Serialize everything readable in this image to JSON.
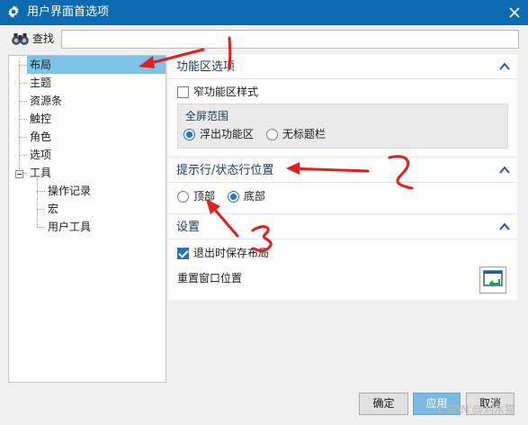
{
  "window": {
    "title": "用户界面首选项",
    "accent": "#0c6bb0"
  },
  "search": {
    "label": "查找",
    "value": ""
  },
  "tree": {
    "items": [
      {
        "label": "布局",
        "selected": true
      },
      {
        "label": "主题"
      },
      {
        "label": "资源条"
      },
      {
        "label": "触控"
      },
      {
        "label": "角色"
      },
      {
        "label": "选项"
      },
      {
        "label": "工具",
        "expanded": true
      },
      {
        "label": "操作记录"
      },
      {
        "label": "宏"
      },
      {
        "label": "用户工具"
      }
    ]
  },
  "sections": {
    "ribbon": {
      "title": "功能区选项",
      "narrow_style": {
        "label": "窄功能区样式",
        "checked": false
      },
      "fullscreen": {
        "title": "全屏范围",
        "options": [
          {
            "label": "浮出功能区",
            "selected": true
          },
          {
            "label": "无标题栏",
            "selected": false
          }
        ]
      }
    },
    "statusbar": {
      "title": "提示行/状态行位置",
      "options": [
        {
          "label": "顶部",
          "selected": false
        },
        {
          "label": "底部",
          "selected": true
        }
      ]
    },
    "settings": {
      "title": "设置",
      "save_on_exit": {
        "label": "退出时保存布局",
        "checked": true
      },
      "reset_window": {
        "label": "重置窗口位置"
      }
    }
  },
  "buttons": {
    "ok": "确定",
    "apply": "应用",
    "cancel": "取消"
  },
  "watermark": "CSDN @刘水猫",
  "annotations": {
    "arrow_color": "#e02020",
    "numbers": [
      "1",
      "2",
      "3"
    ]
  }
}
